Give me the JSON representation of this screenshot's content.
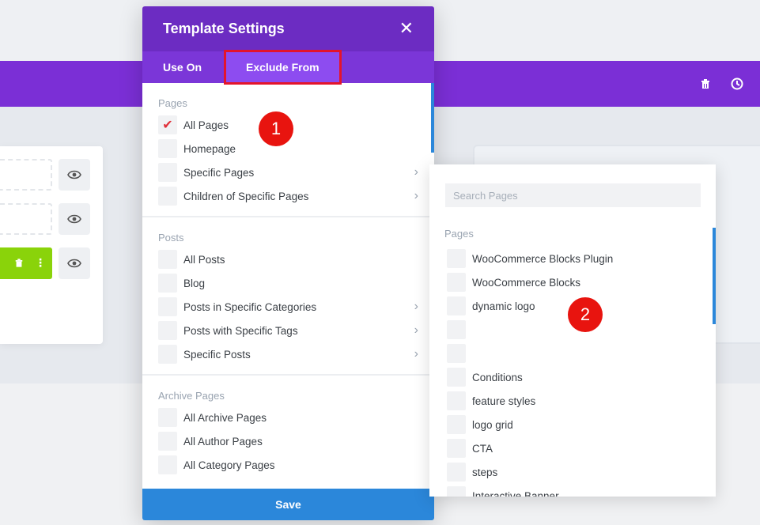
{
  "modal": {
    "title": "Template Settings",
    "tabs": [
      {
        "label": "Use On"
      },
      {
        "label": "Exclude From"
      }
    ],
    "sections": [
      {
        "title": "Pages",
        "options": [
          {
            "label": "All Pages",
            "checked": true
          },
          {
            "label": "Homepage"
          },
          {
            "label": "Specific Pages",
            "has_submenu": true
          },
          {
            "label": "Children of Specific Pages",
            "has_submenu": true
          }
        ]
      },
      {
        "title": "Posts",
        "options": [
          {
            "label": "All Posts"
          },
          {
            "label": "Blog"
          },
          {
            "label": "Posts in Specific Categories",
            "has_submenu": true
          },
          {
            "label": "Posts with Specific Tags",
            "has_submenu": true
          },
          {
            "label": "Specific Posts",
            "has_submenu": true
          }
        ]
      },
      {
        "title": "Archive Pages",
        "options": [
          {
            "label": "All Archive Pages"
          },
          {
            "label": "All Author Pages"
          },
          {
            "label": "All Category Pages"
          }
        ]
      }
    ],
    "save_label": "Save"
  },
  "flyout": {
    "search_placeholder": "Search Pages",
    "section_title": "Pages",
    "items": [
      "WooCommerce Blocks Plugin",
      "WooCommerce Blocks",
      "dynamic logo",
      "",
      "",
      "Conditions",
      "feature styles",
      "logo grid",
      "CTA",
      "steps",
      "Interactive Banner"
    ]
  },
  "markers": [
    "1",
    "2"
  ],
  "colors": {
    "header": "#6c2cc2",
    "tab_bar": "#7b36d8",
    "active_tab": "#8d4cf0",
    "highlight": "#e4142b",
    "save": "#2b87da",
    "topbar": "#7b2fd6",
    "green": "#8ad30a"
  }
}
